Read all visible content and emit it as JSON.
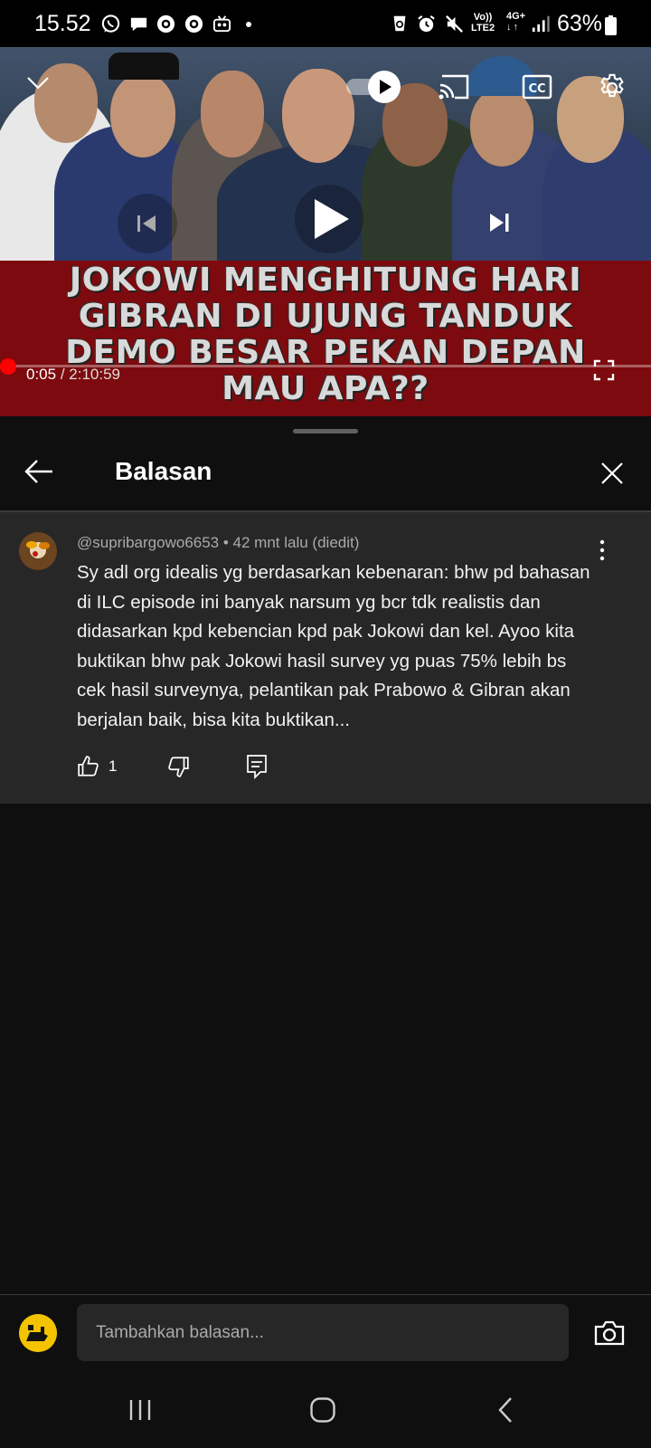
{
  "status_bar": {
    "time": "15.52",
    "network_top": "Vo))",
    "network_bottom": "LTE2",
    "network_type": "4G+",
    "battery": "63%"
  },
  "video": {
    "headline_lines": [
      "JOKOWI MENGHITUNG HARI",
      "GIBRAN DI UJUNG TANDUK",
      "DEMO BESAR PEKAN DEPAN",
      "MAU APA??"
    ],
    "current_time": "0:05",
    "separator": " / ",
    "duration": "2:10:59",
    "progress_fraction": 0.0006,
    "autoplay_on": true
  },
  "sheet": {
    "title": "Balasan"
  },
  "comment": {
    "author": "@supribargowo6653",
    "meta_separator": " • ",
    "time_ago": "42 mnt lalu (diedit)",
    "text": "Sy adl org idealis yg berdasarkan kebenaran: bhw pd bahasan di ILC episode ini banyak narsum yg bcr tdk realistis dan didasarkan kpd kebencian kpd pak Jokowi dan kel. Ayoo kita buktikan bhw pak Jokowi hasil survey yg puas 75% lebih bs cek hasil surveynya, pelantikan pak Prabowo & Gibran akan berjalan baik, bisa kita buktikan...",
    "like_count": "1"
  },
  "reply": {
    "placeholder": "Tambahkan balasan..."
  },
  "colors": {
    "accent_red": "#ff0000",
    "banner_red": "#7d0a0e",
    "surface": "#272727",
    "background": "#0f0f0f"
  },
  "icons": [
    "whatsapp-icon",
    "chat-bubble-icon",
    "record-icon",
    "record-icon",
    "robot-icon",
    "recycle-icon",
    "alarm-icon",
    "mute-icon",
    "signal-icon",
    "battery-icon",
    "chevron-down-icon",
    "autoplay-toggle",
    "cast-icon",
    "cc-icon",
    "gear-icon",
    "previous-icon",
    "play-icon",
    "next-icon",
    "fullscreen-icon",
    "back-arrow-icon",
    "close-icon",
    "more-vert-icon",
    "thumbs-up-icon",
    "thumbs-down-icon",
    "reply-icon",
    "camera-icon",
    "recent-apps-icon",
    "home-icon",
    "nav-back-icon"
  ]
}
